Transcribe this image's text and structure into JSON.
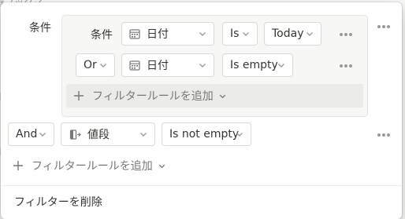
{
  "background": {
    "peek_text": "春ブックマ"
  },
  "filter": {
    "condition_label": "条件",
    "group": {
      "rules": [
        {
          "connector": "条件",
          "property": "日付",
          "property_icon": "calendar-icon",
          "operator": "Is",
          "value": "Today"
        },
        {
          "connector": "Or",
          "property": "日付",
          "property_icon": "calendar-icon",
          "operator": "Is empty"
        }
      ],
      "add_rule_label": "フィルタールールを追加"
    },
    "outer_rule": {
      "connector": "And",
      "property": "値段",
      "property_icon": "formula-icon",
      "operator": "Is not empty"
    },
    "add_rule_label": "フィルタールールを追加",
    "delete_label": "フィルターを削除"
  },
  "colors": {
    "text": "#37352f",
    "muted": "#787774",
    "border": "#d9d9d6",
    "group_bg": "#f7f7f5",
    "add_rule_highlight": "#ebebea"
  }
}
